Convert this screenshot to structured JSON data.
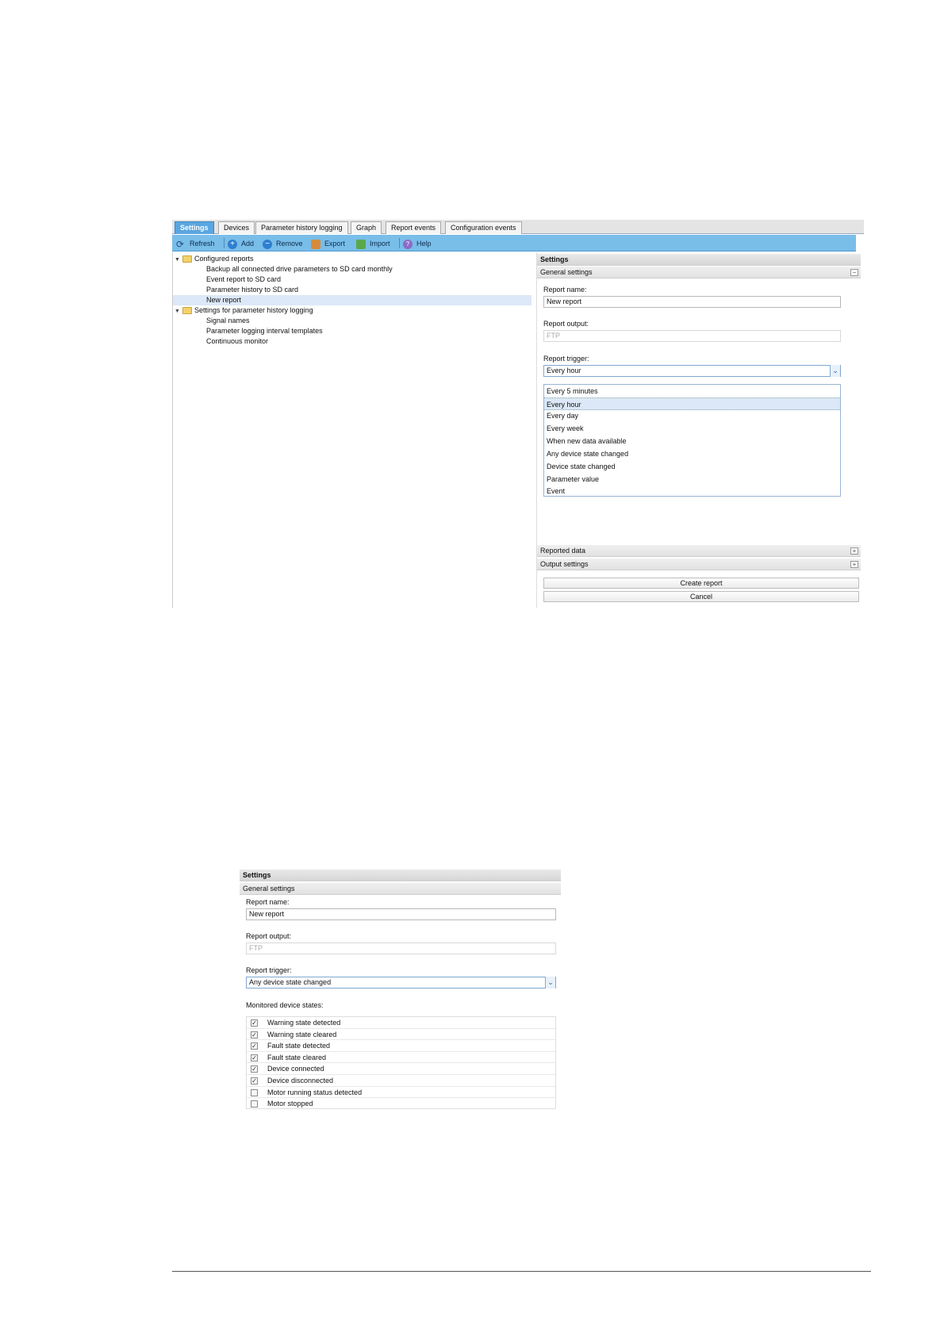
{
  "screenshot1": {
    "tabs": [
      {
        "label": "Settings",
        "active": true
      },
      {
        "label": "Devices"
      },
      {
        "label": "Parameter history logging"
      },
      {
        "label": "Graph"
      },
      {
        "label": "Report events"
      },
      {
        "label": "Configuration events"
      }
    ],
    "toolbar": {
      "refresh": "Refresh",
      "add": "Add",
      "remove": "Remove",
      "export": "Export",
      "import": "Import",
      "help": "Help"
    },
    "tree": {
      "configured_reports": "Configured reports",
      "items": [
        "Backup all connected drive parameters to SD card monthly",
        "Event report to SD card",
        "Parameter history to SD card",
        "New report"
      ],
      "history_logging": "Settings for parameter history logging",
      "history_items": [
        "Signal names",
        "Parameter logging interval templates",
        "Continuous monitor"
      ]
    },
    "settings": {
      "title": "Settings",
      "general": "General settings",
      "report_name_label": "Report name:",
      "report_name_value": "New report",
      "report_output_label": "Report output:",
      "report_output_value": "FTP",
      "report_trigger_label": "Report trigger:",
      "report_trigger_value": "Every hour",
      "trigger_options": [
        "Every 5 minutes",
        "Every hour",
        "Every day",
        "Every week",
        "When new data available",
        "Any device state changed",
        "Device state changed",
        "Parameter value",
        "Event"
      ],
      "highlighted_option": 1,
      "reported_data": "Reported data",
      "output_settings": "Output settings",
      "create_button": "Create report",
      "cancel_button": "Cancel"
    }
  },
  "screenshot2": {
    "title": "Settings",
    "general": "General settings",
    "report_name_label": "Report name:",
    "report_name_value": "New report",
    "report_output_label": "Report output:",
    "report_output_value": "FTP",
    "report_trigger_label": "Report trigger:",
    "report_trigger_value": "Any device state changed",
    "monitored_label": "Monitored device states:",
    "states": [
      {
        "label": "Warning state detected",
        "checked": true
      },
      {
        "label": "Warning state cleared",
        "checked": true
      },
      {
        "label": "Fault state detected",
        "checked": true
      },
      {
        "label": "Fault state cleared",
        "checked": true
      },
      {
        "label": "Device connected",
        "checked": true
      },
      {
        "label": "Device disconnected",
        "checked": true
      },
      {
        "label": "Motor running status detected",
        "checked": false
      },
      {
        "label": "Motor stopped",
        "checked": false
      }
    ]
  }
}
